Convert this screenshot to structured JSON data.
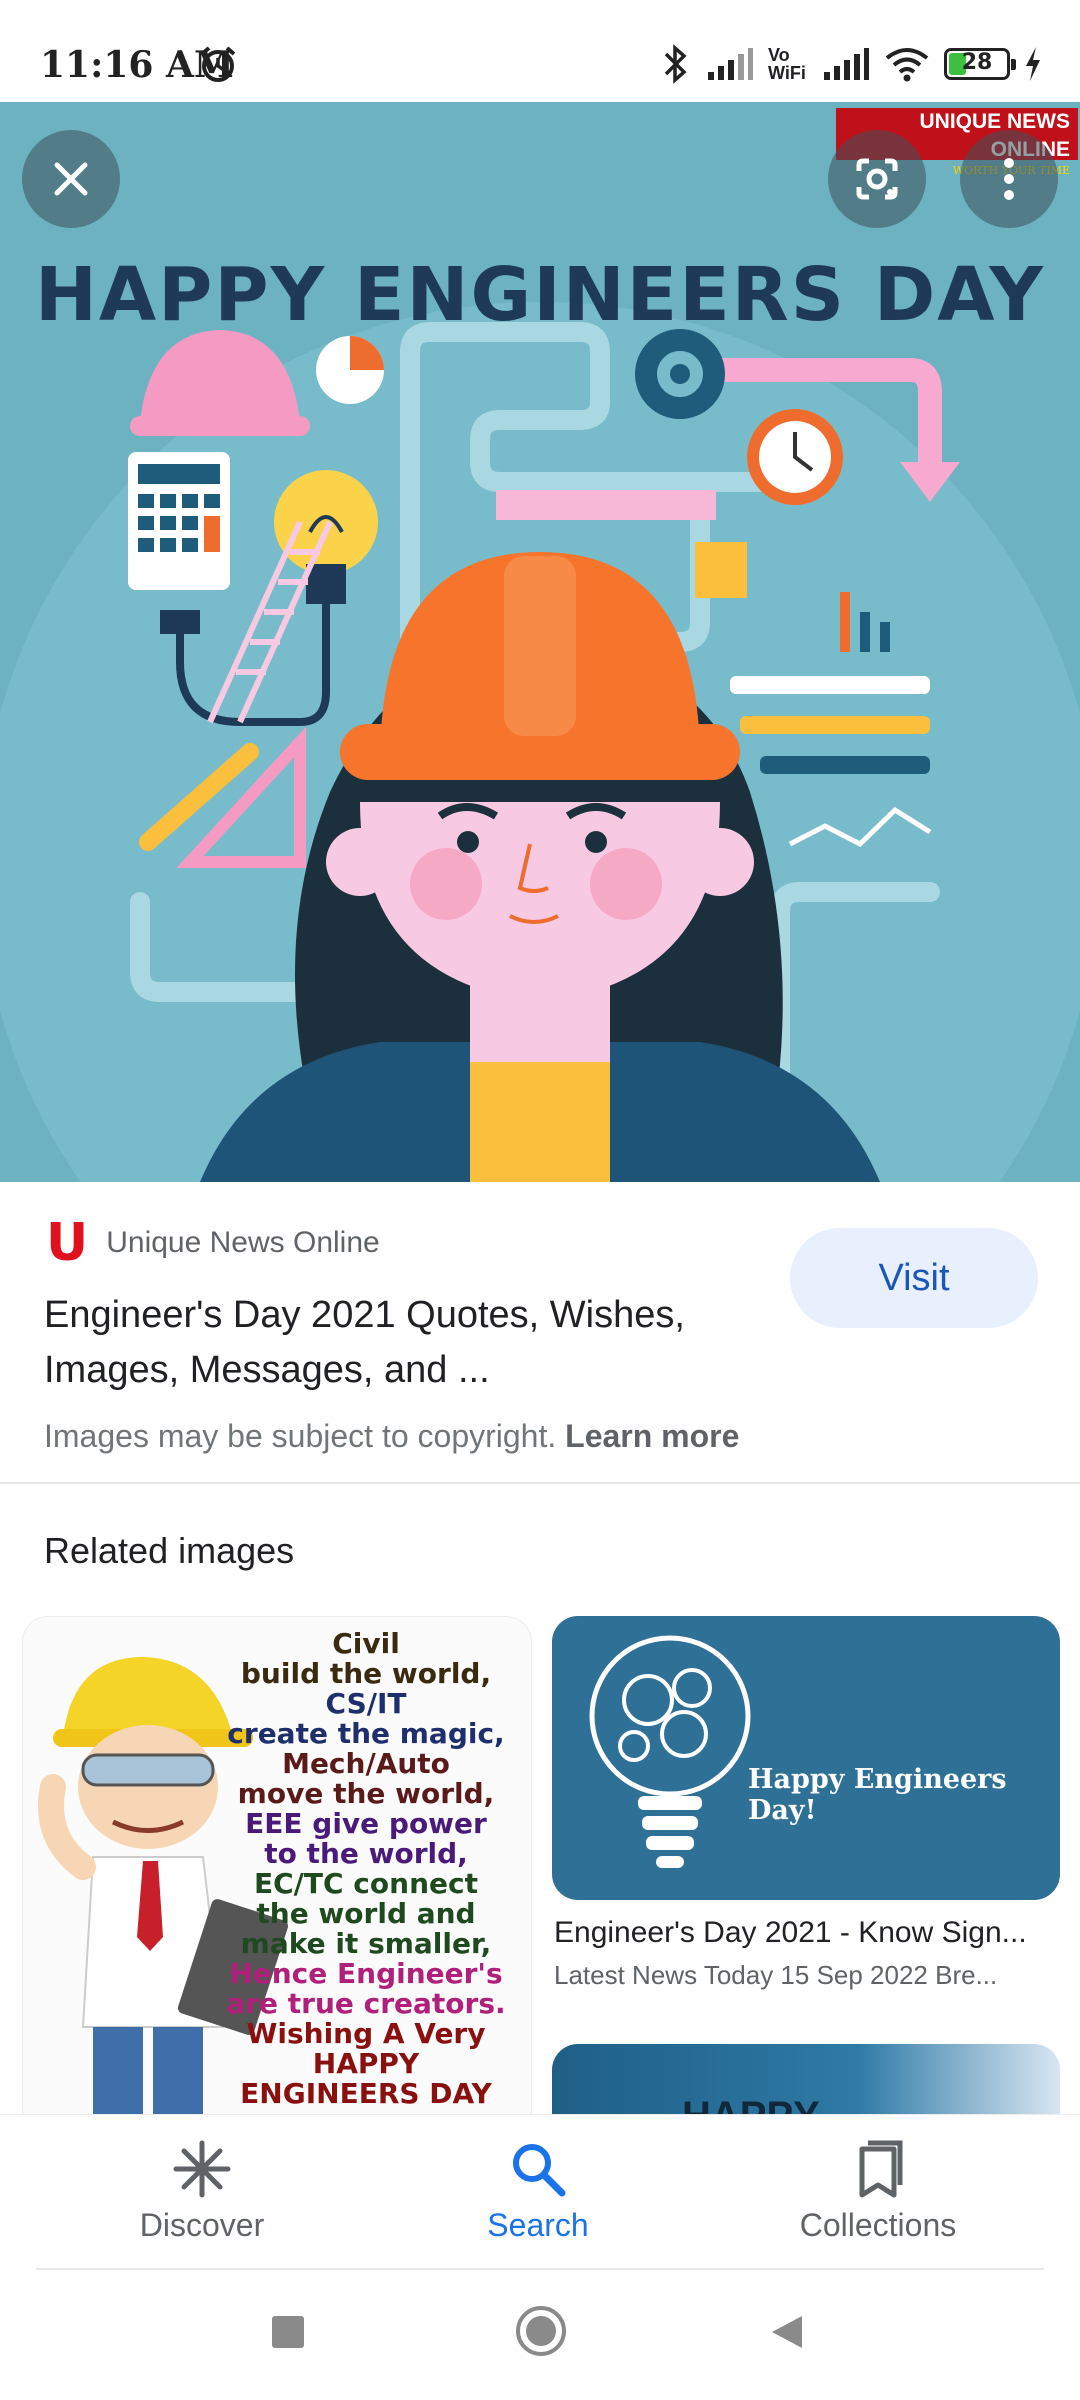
{
  "status_bar": {
    "time": "11:16 AM",
    "battery": "28",
    "network_label": "Vo WiFi"
  },
  "hero": {
    "title": "HAPPY ENGINEERS DAY",
    "watermark_main": "UNIQUE NEWS ONLINE",
    "watermark_sub": "WORTH YOUR TIME"
  },
  "source": {
    "logo_letter": "U",
    "name": "Unique News Online",
    "title": "Engineer's Day 2021 Quotes, Wishes, Images, Messages, and ...",
    "visit_label": "Visit",
    "copyright_text": "Images may be subject to copyright.",
    "learn_more": "Learn more"
  },
  "related": {
    "heading": "Related images",
    "left_card_lines": [
      {
        "text": "Civil",
        "color": "#3a2a10"
      },
      {
        "text": "build the world,",
        "color": "#3a2a10"
      },
      {
        "text": "CS/IT",
        "color": "#1f2f6e"
      },
      {
        "text": "create the magic,",
        "color": "#1f2f6e"
      },
      {
        "text": "Mech/Auto",
        "color": "#5a1a1a"
      },
      {
        "text": "move the world,",
        "color": "#5a1a1a"
      },
      {
        "text": "EEE give power",
        "color": "#4a1a7a"
      },
      {
        "text": "to the world,",
        "color": "#4a1a7a"
      },
      {
        "text": "EC/TC connect",
        "color": "#1f4a1f"
      },
      {
        "text": "the world and",
        "color": "#1f4a1f"
      },
      {
        "text": "make it smaller,",
        "color": "#1f4a1f"
      },
      {
        "text": "Hence Engineer's",
        "color": "#b0207a"
      },
      {
        "text": "are true creators.",
        "color": "#b0207a"
      },
      {
        "text": "Wishing A Very",
        "color": "#8a1010"
      },
      {
        "text": "HAPPY",
        "color": "#8a1010"
      },
      {
        "text": "ENGINEERS DAY",
        "color": "#8a1010"
      }
    ],
    "right_card_image_text": "Happy Engineers Day!",
    "right_card_title": "Engineer's Day 2021 - Know Sign...",
    "right_card_subtitle": "Latest News Today 15 Sep 2022 Bre...",
    "partial_card_text": "HAPPY"
  },
  "bottom_nav": {
    "discover": "Discover",
    "search": "Search",
    "collections": "Collections",
    "active_color": "#1a73e8",
    "inactive_color": "#5f6368"
  }
}
